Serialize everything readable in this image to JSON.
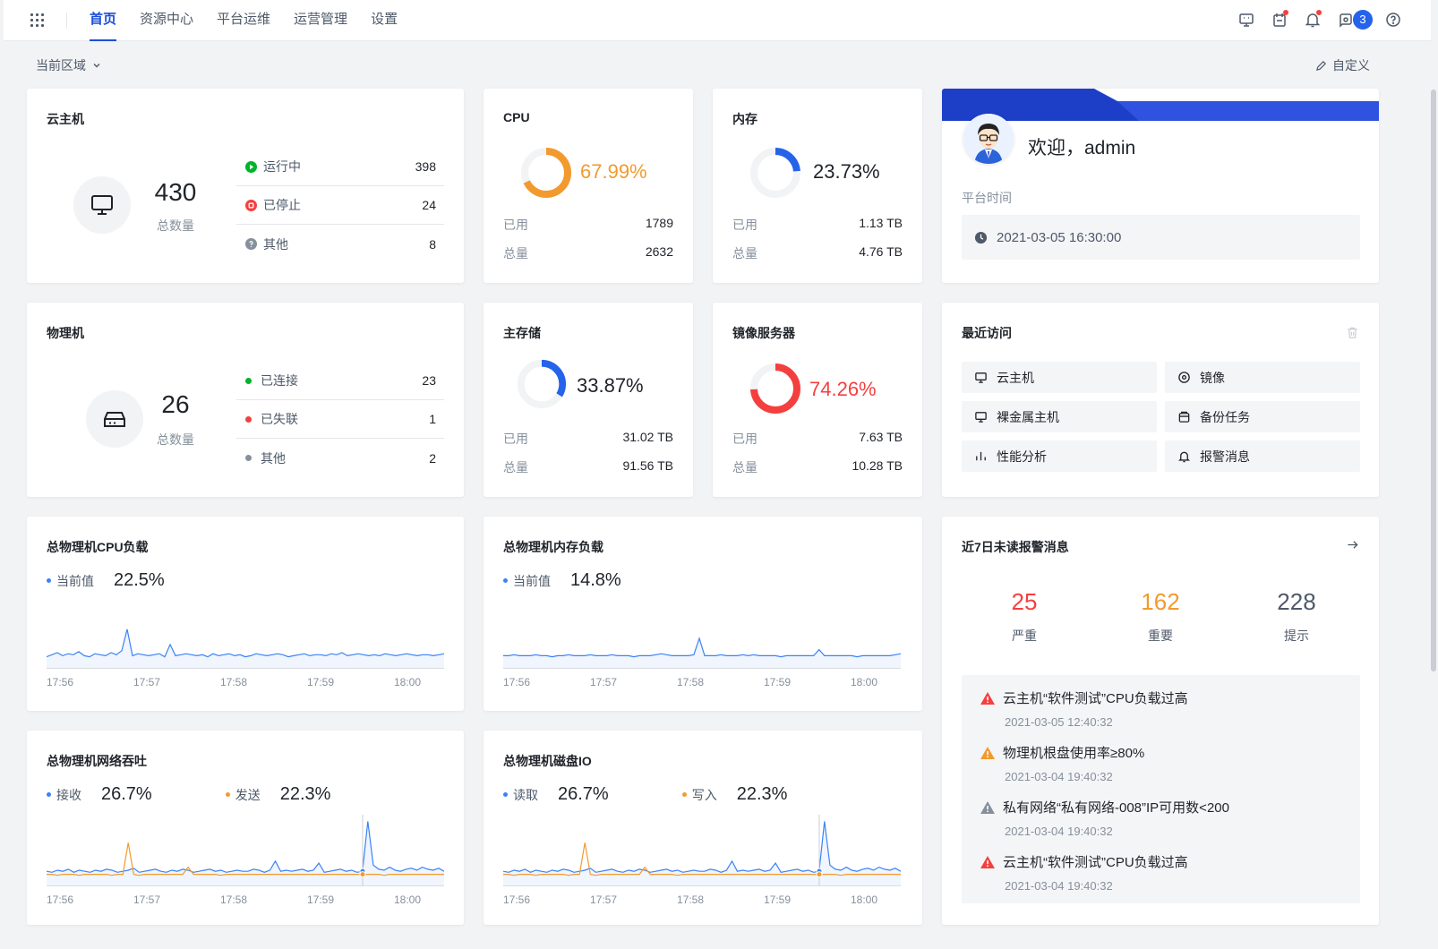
{
  "nav": {
    "items": [
      "首页",
      "资源中心",
      "平台运维",
      "运营管理",
      "设置"
    ],
    "notification_count": "3"
  },
  "toolbar": {
    "region_label": "当前区域",
    "customize_label": "自定义"
  },
  "vm": {
    "title": "云主机",
    "total": "430",
    "total_label": "总数量",
    "statuses": [
      {
        "label": "运行中",
        "value": "398",
        "color": "#00b42a"
      },
      {
        "label": "已停止",
        "value": "24",
        "color": "#f53f3f"
      },
      {
        "label": "其他",
        "value": "8",
        "color": "#86909c"
      }
    ]
  },
  "cpu": {
    "title": "CPU",
    "percent": "67.99%",
    "fraction": 0.6799,
    "color": "#f29a2e",
    "used_label": "已用",
    "used": "1789",
    "total_label": "总量",
    "total": "2632"
  },
  "memory": {
    "title": "内存",
    "percent": "23.73%",
    "fraction": 0.2373,
    "color": "#2563eb",
    "used_label": "已用",
    "used": "1.13 TB",
    "total_label": "总量",
    "total": "4.76 TB"
  },
  "welcome": {
    "greeting": "欢迎，admin",
    "time_label": "平台时间",
    "time": "2021-03-05 16:30:00"
  },
  "host": {
    "title": "物理机",
    "total": "26",
    "total_label": "总数量",
    "statuses": [
      {
        "label": "已连接",
        "value": "23",
        "color": "#00b42a"
      },
      {
        "label": "已失联",
        "value": "1",
        "color": "#f53f3f"
      },
      {
        "label": "其他",
        "value": "2",
        "color": "#86909c"
      }
    ]
  },
  "storage": {
    "title": "主存储",
    "percent": "33.87%",
    "fraction": 0.3387,
    "color": "#2563eb",
    "used_label": "已用",
    "used": "31.02 TB",
    "total_label": "总量",
    "total": "91.56 TB"
  },
  "image_server": {
    "title": "镜像服务器",
    "percent": "74.26%",
    "fraction": 0.7426,
    "color": "#f53f3f",
    "used_label": "已用",
    "used": "7.63 TB",
    "total_label": "总量",
    "total": "10.28 TB"
  },
  "recent": {
    "title": "最近访问",
    "items": [
      {
        "label": "云主机",
        "icon": "monitor-icon"
      },
      {
        "label": "镜像",
        "icon": "disc-icon"
      },
      {
        "label": "裸金属主机",
        "icon": "monitor-icon"
      },
      {
        "label": "备份任务",
        "icon": "backup-icon"
      },
      {
        "label": "性能分析",
        "icon": "bar-chart-icon"
      },
      {
        "label": "报警消息",
        "icon": "bell-icon"
      }
    ]
  },
  "cpu_load": {
    "title": "总物理机CPU负载",
    "current_label": "当前值",
    "current_value": "22.5%"
  },
  "mem_load": {
    "title": "总物理机内存负载",
    "current_label": "当前值",
    "current_value": "14.8%"
  },
  "net": {
    "title": "总物理机网络吞吐",
    "recv_label": "接收",
    "recv_value": "26.7%",
    "send_label": "发送",
    "send_value": "22.3%"
  },
  "disk": {
    "title": "总物理机磁盘IO",
    "read_label": "读取",
    "read_value": "26.7%",
    "write_label": "写入",
    "write_value": "22.3%"
  },
  "time_ticks": [
    "17:56",
    "17:57",
    "17:58",
    "17:59",
    "18:00"
  ],
  "alerts": {
    "title": "近7日未读报警消息",
    "counts": [
      {
        "value": "25",
        "label": "严重",
        "color": "#f53f3f"
      },
      {
        "value": "162",
        "label": "重要",
        "color": "#f29a2e"
      },
      {
        "value": "228",
        "label": "提示",
        "color": "#4e5969"
      }
    ],
    "items": [
      {
        "text": "云主机“软件测试”CPU负载过高",
        "time": "2021-03-05 12:40:32",
        "color": "#f53f3f"
      },
      {
        "text": "物理机根盘使用率≥80%",
        "time": "2021-03-04 19:40:32",
        "color": "#f29a2e"
      },
      {
        "text": "私有网络“私有网络-008”IP可用数<200",
        "time": "2021-03-04 19:40:32",
        "color": "#86909c"
      },
      {
        "text": "云主机“软件测试”CPU负载过高",
        "time": "2021-03-04 19:40:32",
        "color": "#f53f3f"
      }
    ]
  },
  "chart_data": [
    {
      "type": "line",
      "title": "总物理机CPU负载",
      "x": [
        "17:56",
        "17:57",
        "17:58",
        "17:59",
        "18:00"
      ],
      "series": [
        {
          "name": "当前值",
          "color": "#3b82f6",
          "values": [
            3,
            5,
            7,
            4,
            6,
            5,
            8,
            4,
            3,
            6,
            5,
            4,
            7,
            5,
            9,
            30,
            4,
            6,
            5,
            4,
            5,
            6,
            3,
            15,
            4,
            5,
            6,
            5,
            4,
            5,
            3,
            6,
            4,
            5,
            6,
            4,
            5,
            3,
            4,
            6,
            5,
            4,
            5,
            6,
            5,
            3,
            4,
            5,
            6,
            4,
            5,
            5,
            4,
            6,
            5,
            7,
            4,
            5,
            6,
            5,
            4,
            5,
            4,
            6,
            5,
            4,
            5,
            6,
            5,
            4,
            5,
            5,
            4,
            5,
            6
          ]
        }
      ]
    },
    {
      "type": "line",
      "title": "总物理机内存负载",
      "x": [
        "17:56",
        "17:57",
        "17:58",
        "17:59",
        "18:00"
      ],
      "series": [
        {
          "name": "当前值",
          "color": "#3b82f6",
          "values": [
            4,
            4,
            5,
            4,
            4,
            4,
            5,
            4,
            4,
            3,
            4,
            4,
            5,
            4,
            4,
            4,
            5,
            4,
            4,
            4,
            5,
            4,
            4,
            4,
            3,
            4,
            4,
            4,
            5,
            6,
            5,
            4,
            4,
            4,
            4,
            5,
            21,
            4,
            4,
            4,
            5,
            4,
            4,
            4,
            5,
            4,
            5,
            4,
            4,
            4,
            4,
            3,
            4,
            4,
            4,
            4,
            4,
            4,
            10,
            4,
            4,
            4,
            4,
            4,
            4,
            3,
            4,
            4,
            4,
            4,
            4,
            4,
            5,
            6
          ]
        }
      ]
    },
    {
      "type": "line",
      "title": "总物理机网络吞吐",
      "x": [
        "17:56",
        "17:57",
        "17:58",
        "17:59",
        "18:00"
      ],
      "series": [
        {
          "name": "接收",
          "color": "#3b82f6",
          "values": [
            6,
            5,
            7,
            6,
            8,
            5,
            7,
            6,
            5,
            7,
            6,
            8,
            7,
            5,
            6,
            7,
            9,
            5,
            6,
            7,
            8,
            6,
            5,
            7,
            6,
            8,
            7,
            5,
            6,
            7,
            8,
            6,
            7,
            5,
            6,
            7,
            6,
            6,
            8,
            7,
            5,
            7,
            16,
            6,
            7,
            6,
            7,
            8,
            6,
            7,
            14,
            5,
            6,
            7,
            8,
            6,
            7,
            5,
            6,
            55,
            12,
            8,
            7,
            10,
            7,
            6,
            8,
            9,
            7,
            10,
            8,
            7,
            9,
            6
          ]
        },
        {
          "name": "发送",
          "color": "#f29a2e",
          "values": [
            3,
            3,
            2,
            3,
            3,
            3,
            2,
            3,
            3,
            3,
            3,
            3,
            2,
            3,
            3,
            34,
            3,
            2,
            3,
            3,
            3,
            3,
            3,
            3,
            3,
            3,
            10,
            3,
            3,
            3,
            3,
            3,
            2,
            3,
            3,
            3,
            3,
            3,
            3,
            3,
            3,
            3,
            3,
            3,
            3,
            3,
            3,
            3,
            3,
            3,
            3,
            3,
            3,
            3,
            3,
            3,
            3,
            3,
            3,
            3,
            3,
            3,
            2,
            3,
            3,
            3,
            3,
            3,
            3,
            3,
            3,
            3,
            3,
            3
          ]
        }
      ]
    },
    {
      "type": "line",
      "title": "总物理机磁盘IO",
      "x": [
        "17:56",
        "17:57",
        "17:58",
        "17:59",
        "18:00"
      ],
      "series": [
        {
          "name": "读取",
          "color": "#3b82f6",
          "values": [
            6,
            5,
            7,
            6,
            8,
            5,
            7,
            6,
            5,
            7,
            6,
            8,
            7,
            5,
            6,
            7,
            9,
            5,
            6,
            7,
            8,
            6,
            5,
            7,
            6,
            8,
            7,
            5,
            6,
            7,
            8,
            6,
            7,
            5,
            6,
            7,
            6,
            6,
            8,
            7,
            5,
            7,
            16,
            6,
            7,
            6,
            7,
            8,
            6,
            7,
            14,
            5,
            6,
            7,
            8,
            6,
            7,
            5,
            6,
            55,
            12,
            8,
            7,
            10,
            7,
            6,
            8,
            9,
            7,
            10,
            8,
            7,
            9,
            6
          ]
        },
        {
          "name": "写入",
          "color": "#f29a2e",
          "values": [
            3,
            3,
            2,
            3,
            3,
            3,
            2,
            3,
            3,
            3,
            3,
            3,
            2,
            3,
            3,
            34,
            3,
            2,
            3,
            3,
            3,
            3,
            3,
            3,
            3,
            3,
            10,
            3,
            3,
            3,
            3,
            3,
            2,
            3,
            3,
            3,
            3,
            3,
            3,
            3,
            3,
            3,
            3,
            3,
            3,
            3,
            3,
            3,
            3,
            3,
            3,
            3,
            3,
            3,
            3,
            3,
            3,
            3,
            3,
            3,
            3,
            3,
            2,
            3,
            3,
            3,
            3,
            3,
            3,
            3,
            3,
            3,
            3,
            3
          ]
        }
      ]
    }
  ]
}
